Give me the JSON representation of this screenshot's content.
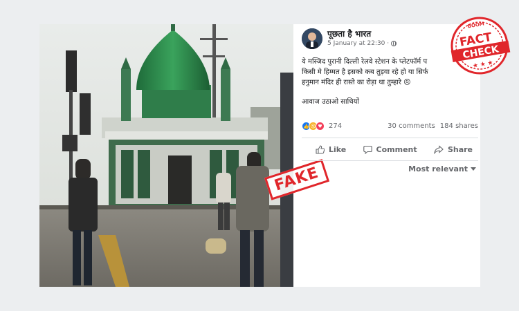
{
  "post": {
    "page_name": "पूछता है भारत",
    "timestamp": "5 January at 22:30 ·",
    "lines": [
      "ये मस्जिद पुरानी दिल्ली रेलवे स्टेशन के प्लेटफॉर्म प",
      "किसी मे हिम्मत है इसको कब तुड़वा रहे हो या सिर्फ",
      "हनुमान मंदिर ही रास्ते का रोड़ा था तुम्हारे 😠"
    ],
    "call_to_action": "आवाज उठाओ साथियों"
  },
  "stats": {
    "reaction_count": "274",
    "comments": "30 comments",
    "shares": "184 shares",
    "reaction_icons": [
      "like-icon",
      "wow-icon",
      "love-icon"
    ]
  },
  "actions": {
    "like": "Like",
    "comment": "Comment",
    "share": "Share"
  },
  "sort_label": "Most relevant",
  "stamps": {
    "fake": "FAKE",
    "fact_check_top": "BOOM",
    "fact_check_word1": "FACT",
    "fact_check_word2": "CHECK"
  },
  "colors": {
    "stamp_red": "#e0262b",
    "facebook_blue": "#1877f2",
    "dome_green": "#2f8f4e"
  }
}
